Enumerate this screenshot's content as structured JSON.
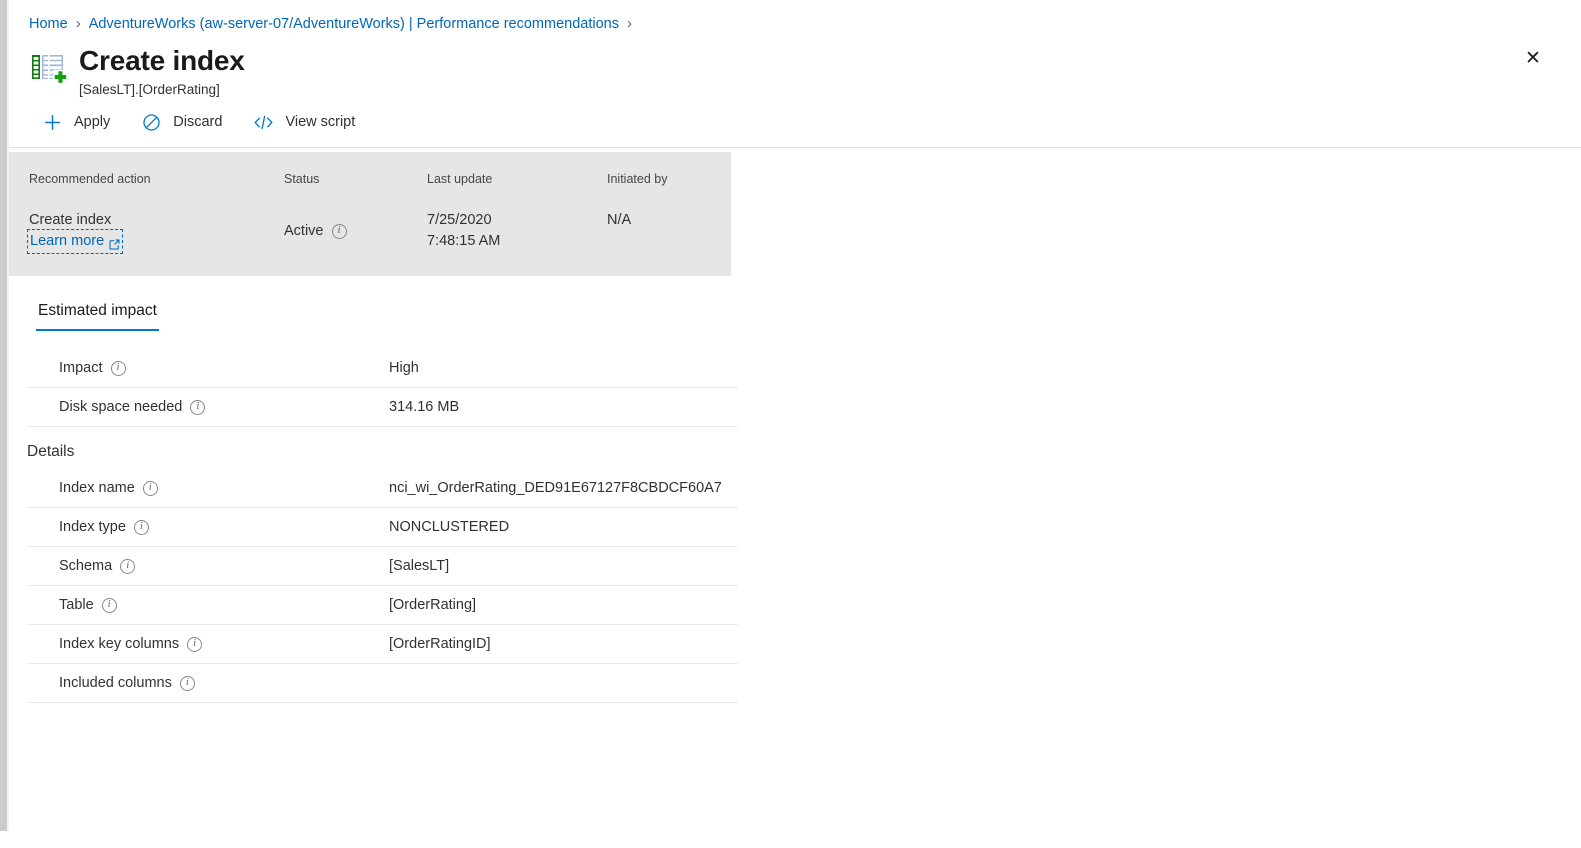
{
  "breadcrumb": {
    "items": [
      {
        "label": "Home",
        "icon": "none"
      },
      {
        "label": "AdventureWorks (aw-server-07/AdventureWorks) | Performance recommendations",
        "icon": "none"
      }
    ],
    "separator": "›",
    "trailing_separator": "›"
  },
  "header": {
    "icon": "create-index-table-icon",
    "title": "Create index",
    "subtitle": "[SalesLT].[OrderRating]",
    "close_label": "✕"
  },
  "toolbar": {
    "items": [
      {
        "label": "Apply",
        "icon": "plus-icon"
      },
      {
        "label": "Discard",
        "icon": "circle-slash-icon"
      },
      {
        "label": "View script",
        "icon": "code-icon"
      }
    ]
  },
  "info_strip": {
    "headers": {
      "recommended_action": "Recommended action",
      "status": "Status",
      "last_update": "Last update",
      "initiated_by": "Initiated by"
    },
    "values": {
      "recommended_action": "Create index",
      "learn_more": "Learn more",
      "status": "Active",
      "last_update_date": "7/25/2020",
      "last_update_time": "7:48:15 AM",
      "initiated_by": "N/A"
    }
  },
  "tabs": [
    {
      "label": "Estimated impact",
      "active": true
    }
  ],
  "estimated_impact": {
    "rows": [
      {
        "label": "Impact",
        "value": "High",
        "info": true
      },
      {
        "label": "Disk space needed",
        "value": "314.16 MB",
        "info": true
      }
    ]
  },
  "details": {
    "section_title": "Details",
    "rows": [
      {
        "label": "Index name",
        "value": "nci_wi_OrderRating_DED91E67127F8CBDCF60A7",
        "info": true
      },
      {
        "label": "Index type",
        "value": "NONCLUSTERED",
        "info": true
      },
      {
        "label": "Schema",
        "value": "[SalesLT]",
        "info": true
      },
      {
        "label": "Table",
        "value": "[OrderRating]",
        "info": true
      },
      {
        "label": "Index key columns",
        "value": "[OrderRatingID]",
        "info": true
      },
      {
        "label": "Included columns",
        "value": "",
        "info": true
      }
    ]
  },
  "colors": {
    "link": "#0067b8",
    "accent": "#0078d4",
    "info_strip_bg": "#e6e6e6",
    "icon_green": "#107c10",
    "icon_blue": "#a6b7dc",
    "divider": "#edebe9",
    "text": "#323130"
  }
}
